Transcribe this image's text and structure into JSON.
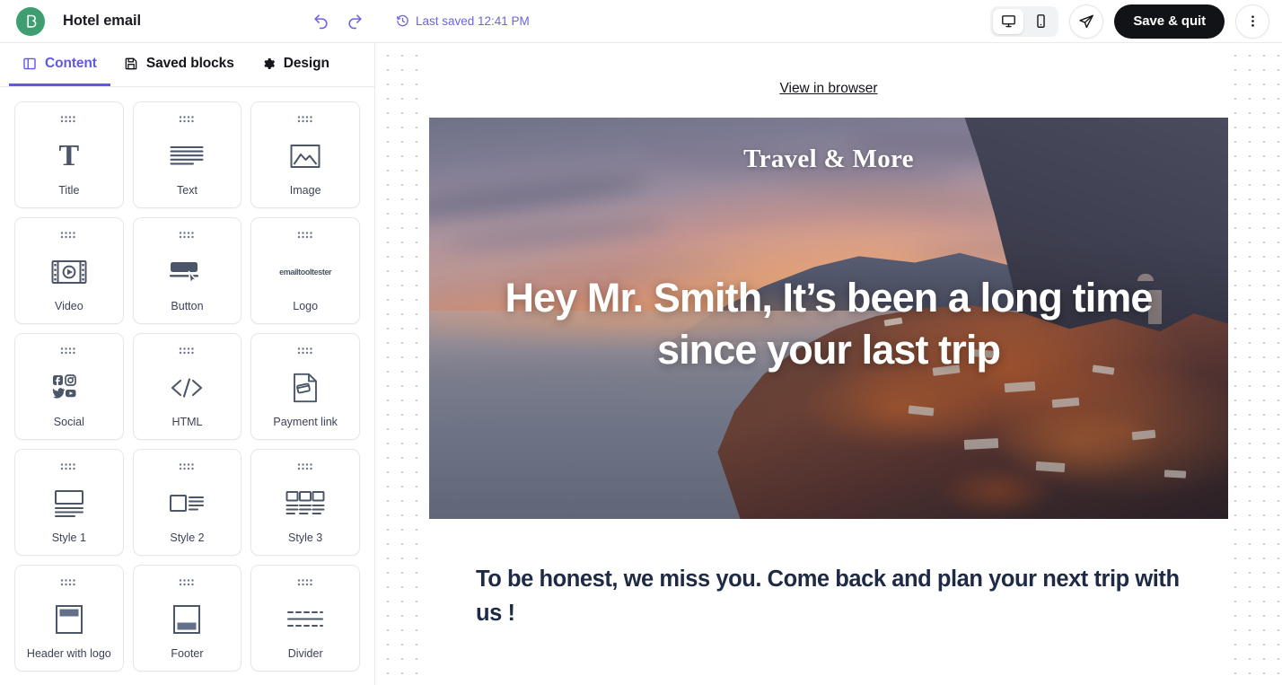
{
  "topbar": {
    "logo_icon": "brevo-b-logo",
    "title": "Hotel email",
    "undo_icon": "undo-arrow-icon",
    "redo_icon": "redo-arrow-icon",
    "saved_clock_icon": "clock-history-icon",
    "saved_text": "Last saved 12:41 PM",
    "device_toggle": {
      "desktop_icon": "desktop-monitor-icon",
      "mobile_icon": "mobile-phone-icon",
      "active": "desktop"
    },
    "send_test_icon": "paper-plane-icon",
    "save_quit_label": "Save & quit",
    "more_icon": "more-vertical-icon",
    "accent_color": "#6156e8",
    "logo_color": "#3f9e71",
    "button_color": "#121317"
  },
  "sidepanel": {
    "tabs": [
      {
        "label": "Content",
        "icon": "panel-layout-icon",
        "active": true
      },
      {
        "label": "Saved blocks",
        "icon": "floppy-save-icon",
        "active": false
      },
      {
        "label": "Design",
        "icon": "gear-icon",
        "active": false
      }
    ],
    "blocks": [
      {
        "label": "Title",
        "icon": "title-T-icon"
      },
      {
        "label": "Text",
        "icon": "text-lines-icon"
      },
      {
        "label": "Image",
        "icon": "image-mountain-icon"
      },
      {
        "label": "Video",
        "icon": "video-film-play-icon"
      },
      {
        "label": "Button",
        "icon": "button-cursor-icon"
      },
      {
        "label": "Logo",
        "icon": "logo-wordmark-icon",
        "wordmark": "emailtooltester"
      },
      {
        "label": "Social",
        "icon": "social-networks-icon"
      },
      {
        "label": "HTML",
        "icon": "code-brackets-icon"
      },
      {
        "label": "Payment link",
        "icon": "payment-card-document-icon"
      },
      {
        "label": "Style 1",
        "icon": "layout-style-1-icon"
      },
      {
        "label": "Style 2",
        "icon": "layout-style-2-icon"
      },
      {
        "label": "Style 3",
        "icon": "layout-style-3-icon"
      },
      {
        "label": "Header with logo",
        "icon": "header-with-logo-icon"
      },
      {
        "label": "Footer",
        "icon": "footer-icon"
      },
      {
        "label": "Divider",
        "icon": "divider-icon"
      }
    ]
  },
  "canvas": {
    "view_in_browser": "View in browser",
    "hero": {
      "brand": "Travel & More",
      "headline": "Hey Mr. Smith, It’s been a long time since your last trip",
      "alt": "sunset over coastal cliff village"
    },
    "body": {
      "lead": "To be honest, we miss you. Come back and plan your next trip with us !",
      "text_color": "#1f2a44"
    }
  }
}
